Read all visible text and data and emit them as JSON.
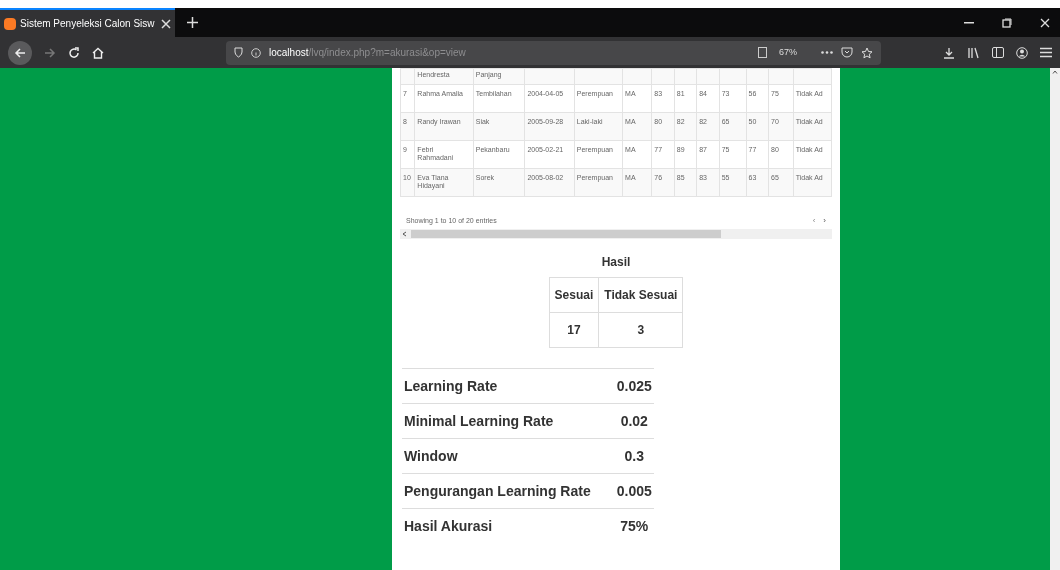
{
  "browser": {
    "tab_title": "Sistem Penyeleksi Calon Sisw",
    "url_host": "localhost",
    "url_path": "/lvq/index.php?m=akurasi&op=view",
    "zoom": "67%"
  },
  "table": {
    "rows": [
      [
        "",
        "Hendresta",
        "Panjang",
        "",
        "",
        "",
        "",
        "",
        "",
        "",
        "",
        "",
        ""
      ],
      [
        "7",
        "Rahma Amalia",
        "Tembilahan",
        "2004-04-05",
        "Perempuan",
        "MA",
        "83",
        "81",
        "84",
        "73",
        "56",
        "75",
        "Tidak Ad"
      ],
      [
        "8",
        "Randy Irawan",
        "Siak",
        "2005-09-28",
        "Laki-laki",
        "MA",
        "80",
        "82",
        "82",
        "65",
        "50",
        "70",
        "Tidak Ad"
      ],
      [
        "9",
        "Febri Rahmadani",
        "Pekanbaru",
        "2005-02-21",
        "Perempuan",
        "MA",
        "77",
        "89",
        "87",
        "75",
        "77",
        "80",
        "Tidak Ad"
      ],
      [
        "10",
        "Eva Tiana Hidayani",
        "Sorek",
        "2005-08-02",
        "Perempuan",
        "MA",
        "76",
        "85",
        "83",
        "55",
        "63",
        "65",
        "Tidak Ad"
      ]
    ],
    "info": "Showing 1 to 10 of 20 entries",
    "prev": "‹",
    "next": "›"
  },
  "hasil": {
    "title": "Hasil",
    "columns": [
      "Sesuai",
      "Tidak Sesuai"
    ],
    "values": [
      "17",
      "3"
    ]
  },
  "params": [
    {
      "label": "Learning Rate",
      "value": "0.025"
    },
    {
      "label": "Minimal Learning Rate",
      "value": "0.02"
    },
    {
      "label": "Window",
      "value": "0.3"
    },
    {
      "label": "Pengurangan Learning Rate",
      "value": "0.005"
    },
    {
      "label": "Hasil Akurasi",
      "value": "75%"
    }
  ]
}
